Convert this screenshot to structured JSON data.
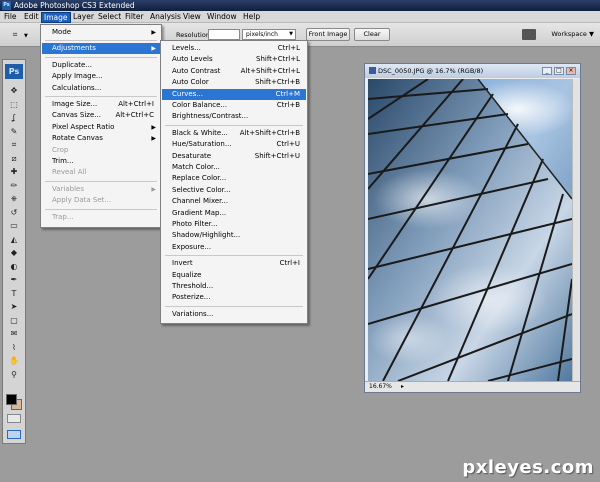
{
  "app": {
    "title": "Adobe Photoshop CS3 Extended",
    "ps_label": "Ps"
  },
  "menubar": [
    "File",
    "Edit",
    "Image",
    "Layer",
    "Select",
    "Filter",
    "Analysis",
    "View",
    "Window",
    "Help"
  ],
  "options": {
    "resolution_label": "Resolution:",
    "resolution_value": "",
    "units": "pixels/inch",
    "front_image": "Front Image",
    "clear": "Clear",
    "workspace": "Workspace"
  },
  "image_menu": [
    {
      "label": "Mode",
      "submenu": true
    },
    {
      "sep": true
    },
    {
      "label": "Adjustments",
      "submenu": true,
      "highlighted": true
    },
    {
      "sep": true
    },
    {
      "label": "Duplicate..."
    },
    {
      "label": "Apply Image..."
    },
    {
      "label": "Calculations..."
    },
    {
      "sep": true
    },
    {
      "label": "Image Size...",
      "shortcut": "Alt+Ctrl+I"
    },
    {
      "label": "Canvas Size...",
      "shortcut": "Alt+Ctrl+C"
    },
    {
      "label": "Pixel Aspect Ratio",
      "submenu": true
    },
    {
      "label": "Rotate Canvas",
      "submenu": true
    },
    {
      "label": "Crop",
      "disabled": true
    },
    {
      "label": "Trim..."
    },
    {
      "label": "Reveal All",
      "disabled": true
    },
    {
      "sep": true
    },
    {
      "label": "Variables",
      "submenu": true,
      "disabled": true
    },
    {
      "label": "Apply Data Set...",
      "disabled": true
    },
    {
      "sep": true
    },
    {
      "label": "Trap...",
      "disabled": true
    }
  ],
  "adjustments_menu": [
    {
      "label": "Levels...",
      "shortcut": "Ctrl+L"
    },
    {
      "label": "Auto Levels",
      "shortcut": "Shift+Ctrl+L"
    },
    {
      "label": "Auto Contrast",
      "shortcut": "Alt+Shift+Ctrl+L"
    },
    {
      "label": "Auto Color",
      "shortcut": "Shift+Ctrl+B"
    },
    {
      "label": "Curves...",
      "shortcut": "Ctrl+M",
      "highlighted": true
    },
    {
      "label": "Color Balance...",
      "shortcut": "Ctrl+B"
    },
    {
      "label": "Brightness/Contrast..."
    },
    {
      "sep": true
    },
    {
      "label": "Black & White...",
      "shortcut": "Alt+Shift+Ctrl+B"
    },
    {
      "label": "Hue/Saturation...",
      "shortcut": "Ctrl+U"
    },
    {
      "label": "Desaturate",
      "shortcut": "Shift+Ctrl+U"
    },
    {
      "label": "Match Color..."
    },
    {
      "label": "Replace Color..."
    },
    {
      "label": "Selective Color..."
    },
    {
      "label": "Channel Mixer..."
    },
    {
      "label": "Gradient Map..."
    },
    {
      "label": "Photo Filter..."
    },
    {
      "label": "Shadow/Highlight..."
    },
    {
      "label": "Exposure..."
    },
    {
      "sep": true
    },
    {
      "label": "Invert",
      "shortcut": "Ctrl+I"
    },
    {
      "label": "Equalize"
    },
    {
      "label": "Threshold..."
    },
    {
      "label": "Posterize..."
    },
    {
      "sep": true
    },
    {
      "label": "Variations..."
    }
  ],
  "document": {
    "title": "DSC_0050.JPG @ 16.7% (RGB/8)",
    "zoom": "16.67%"
  },
  "tools": [
    "move-tool",
    "marquee-tool",
    "lasso-tool",
    "quick-select-tool",
    "crop-tool",
    "slice-tool",
    "healing-brush-tool",
    "brush-tool",
    "clone-stamp-tool",
    "history-brush-tool",
    "eraser-tool",
    "paint-bucket-tool",
    "blur-tool",
    "dodge-tool",
    "pen-tool",
    "type-tool",
    "path-select-tool",
    "shape-tool",
    "notes-tool",
    "eyedropper-tool",
    "hand-tool",
    "zoom-tool"
  ],
  "colors": {
    "menu_highlight": "#2a76d2",
    "foreground": "#000000",
    "background": "#d8b89a"
  },
  "watermark": "pxleyes.com"
}
